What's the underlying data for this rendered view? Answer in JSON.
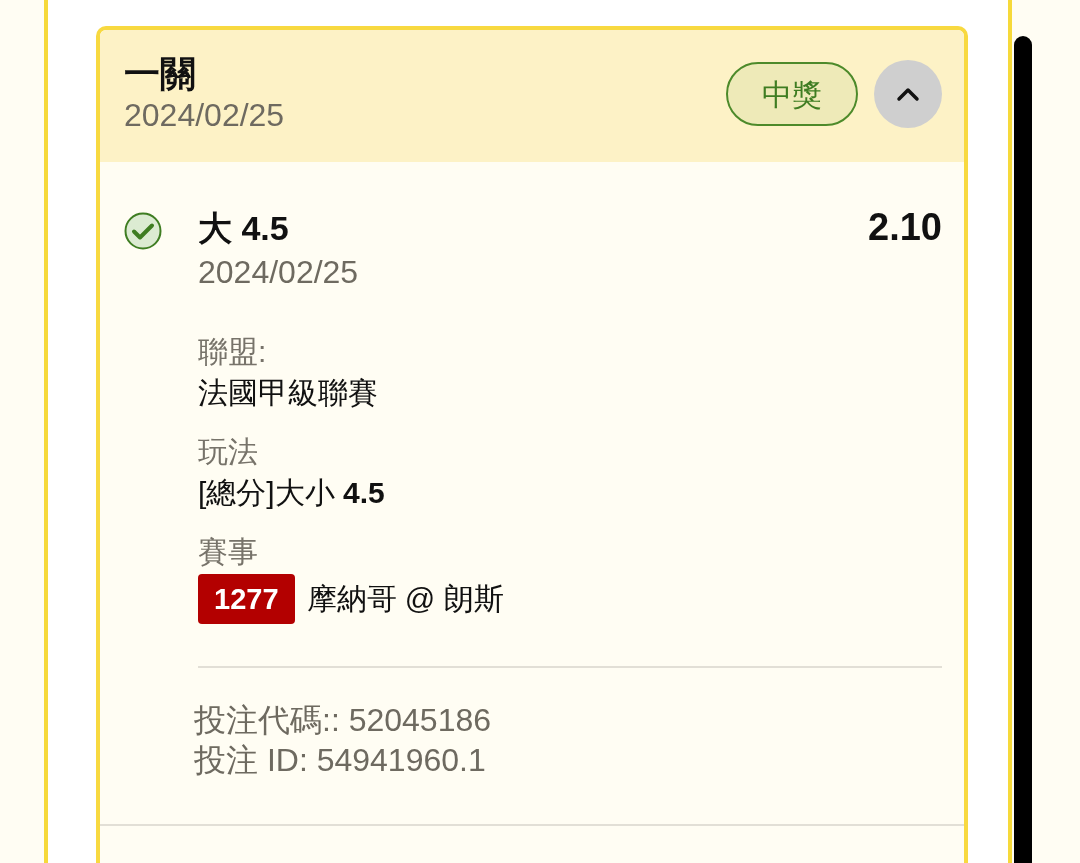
{
  "bet": {
    "title": "一關",
    "date": "2024/02/25",
    "status": {
      "label": "中獎",
      "kind": "won"
    },
    "expanded": true,
    "selections": [
      {
        "won": true,
        "name": "大 4.5",
        "odds": "2.10",
        "date": "2024/02/25",
        "fields": [
          {
            "kind": "text",
            "label": "聯盟:",
            "value": "法國甲級聯賽"
          },
          {
            "kind": "text",
            "label": "玩法",
            "value": "[總分]大小 **4.5**"
          },
          {
            "kind": "event",
            "label": "賽事",
            "code": "1277",
            "value": "摩納哥 @ 朗斯"
          }
        ]
      }
    ],
    "codes": [
      "投注代碼:: 52045186",
      "投注 ID: 54941960.1"
    ]
  }
}
